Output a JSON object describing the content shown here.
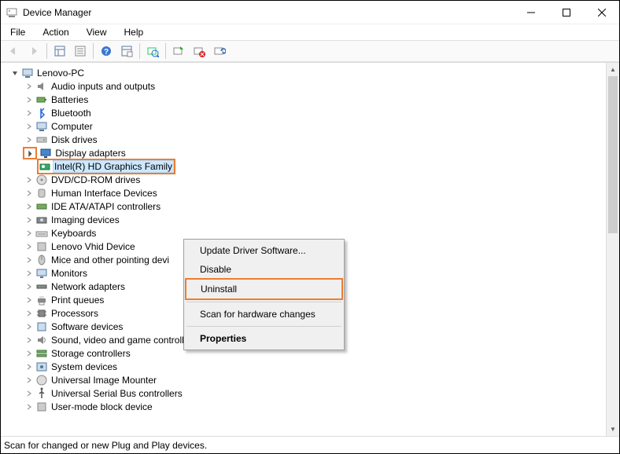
{
  "window": {
    "title": "Device Manager"
  },
  "menu": {
    "file": "File",
    "action": "Action",
    "view": "View",
    "help": "Help"
  },
  "tree": {
    "root": "Lenovo-PC",
    "items": [
      "Audio inputs and outputs",
      "Batteries",
      "Bluetooth",
      "Computer",
      "Disk drives",
      "Display adapters",
      "DVD/CD-ROM drives",
      "Human Interface Devices",
      "IDE ATA/ATAPI controllers",
      "Imaging devices",
      "Keyboards",
      "Lenovo Vhid Device",
      "Mice and other pointing devi",
      "Monitors",
      "Network adapters",
      "Print queues",
      "Processors",
      "Software devices",
      "Sound, video and game controllers",
      "Storage controllers",
      "System devices",
      "Universal Image Mounter",
      "Universal Serial Bus controllers",
      "User-mode block device"
    ],
    "display_child": "Intel(R) HD Graphics Family"
  },
  "context_menu": {
    "update": "Update Driver Software...",
    "disable": "Disable",
    "uninstall": "Uninstall",
    "scan": "Scan for hardware changes",
    "properties": "Properties"
  },
  "status": "Scan for changed or new Plug and Play devices."
}
